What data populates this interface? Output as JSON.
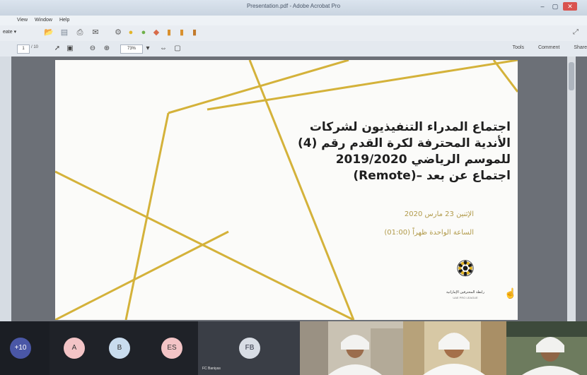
{
  "window": {
    "title": "Presentation.pdf - Adobe Acrobat Pro",
    "controls": [
      "–",
      "▢",
      "✕"
    ]
  },
  "menu": {
    "items": [
      "View",
      "Window",
      "Help"
    ]
  },
  "toolbar": {
    "create_label": "eate ▾"
  },
  "nav": {
    "page_current": "1",
    "page_total": "/ 10",
    "zoom": "73%",
    "tools_label": "Tools",
    "comment_label": "Comment",
    "share_label": "Share"
  },
  "slide": {
    "title_lines": [
      "اجتماع المدراء التنفيذيون لشركات",
      "الأندية المحترفة لكرة القدم رقم (4)",
      "للموسم الرياضي 2019/2020",
      "اجتماع عن بعد –(Remote)"
    ],
    "date_line": "الإثنين 23 مارس 2020",
    "time_line": "الساعة الواحدة ظهراً (01:00)",
    "logo_text": "رابطة المحترفين الإماراتية",
    "logo_sub": "UAE PRO LEAGUE",
    "accent_color": "#d4b23a"
  },
  "meeting": {
    "gallery_count": "+10",
    "participants": [
      {
        "initials": "A",
        "color": "#f3c4c6"
      },
      {
        "initials": "B",
        "color": "#c9dcee"
      },
      {
        "initials": "ES",
        "color": "#f3c4c6"
      }
    ],
    "active_tile": {
      "initials": "FB",
      "label": "FC Baniyas"
    }
  }
}
